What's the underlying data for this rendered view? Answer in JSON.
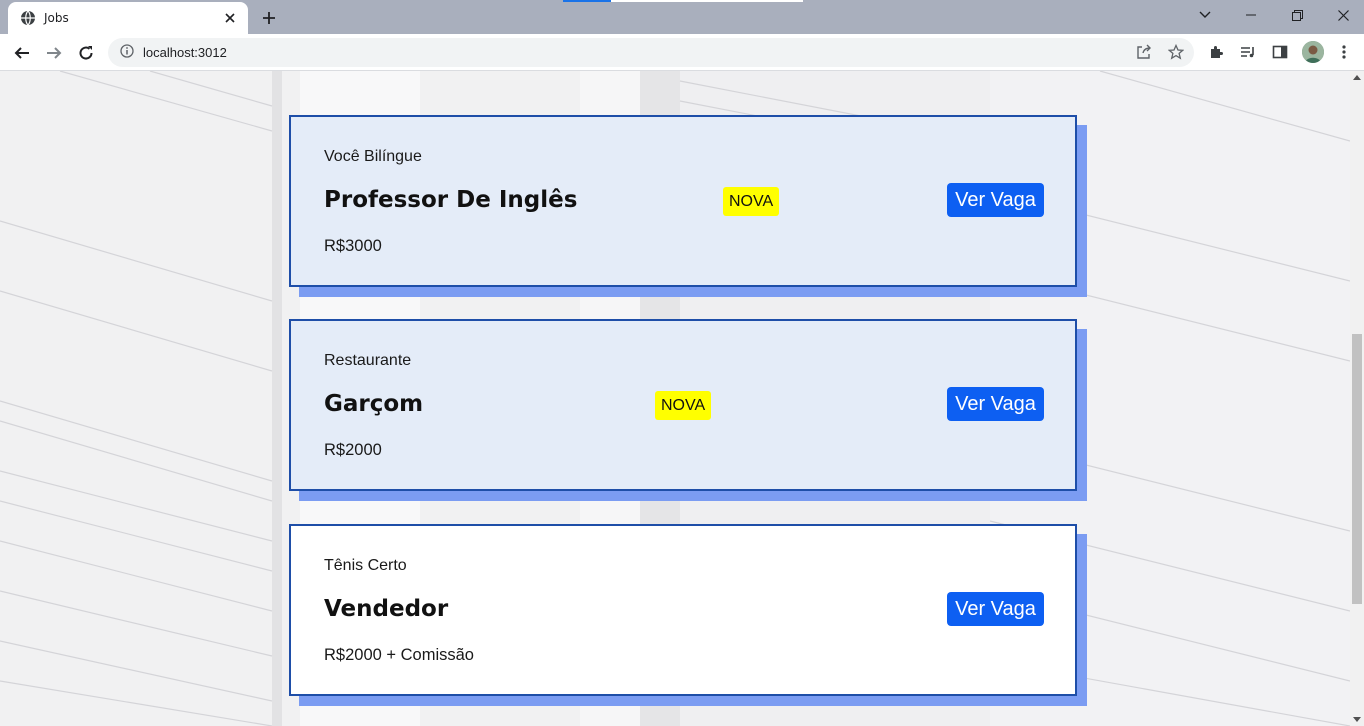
{
  "browser": {
    "tab_title": "Jobs",
    "url": "localhost:3012"
  },
  "jobs": [
    {
      "company": "Você Bilíngue",
      "title": "Professor De Inglês",
      "badge": "NOVA",
      "salary": "R$3000",
      "button": "Ver Vaga",
      "highlighted": true
    },
    {
      "company": "Restaurante",
      "title": "Garçom",
      "badge": "NOVA",
      "salary": "R$2000",
      "button": "Ver Vaga",
      "highlighted": true
    },
    {
      "company": "Tênis Certo",
      "title": "Vendedor",
      "badge": null,
      "salary": "R$2000 + Comissão",
      "button": "Ver Vaga",
      "highlighted": false
    }
  ],
  "colors": {
    "card_border": "#1e4ea8",
    "card_shadow": "#7b9cf2",
    "card_highlight_bg": "#e4ecf8",
    "badge_bg": "#ffff00",
    "button_bg": "#0d5ff2"
  }
}
